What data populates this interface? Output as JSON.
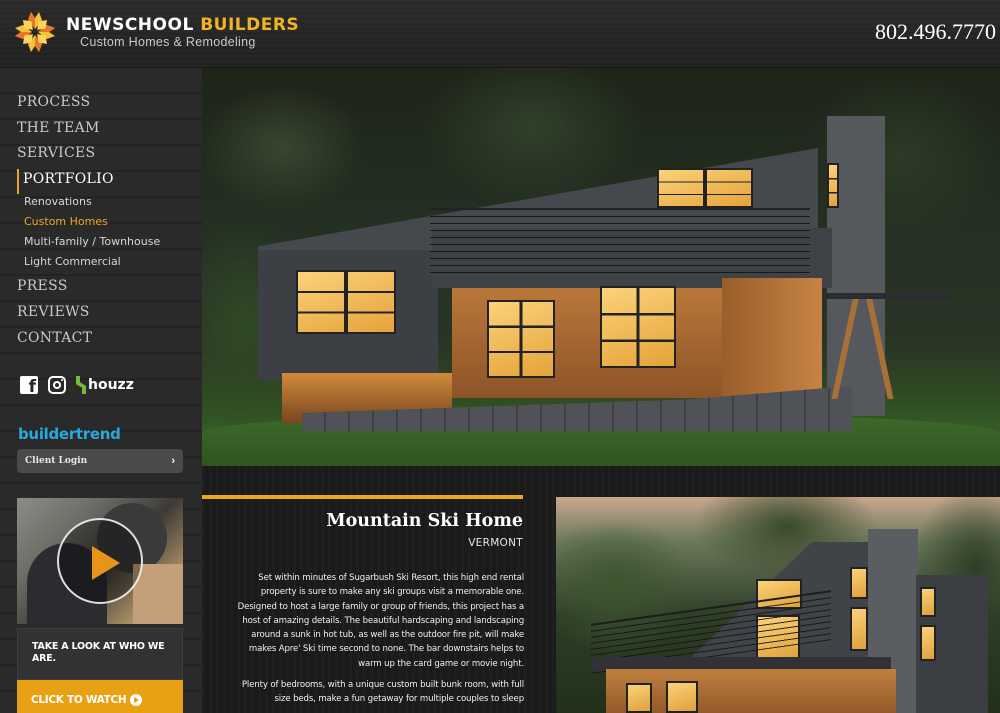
{
  "header": {
    "brand_primary": "NEWSCHOOL",
    "brand_secondary": "BUILDERS",
    "tagline": "Custom Homes & Remodeling",
    "phone": "802.496.7770",
    "colors": {
      "accent": "#f2b324",
      "background": "#262626"
    }
  },
  "nav": {
    "items": [
      {
        "label": "PROCESS"
      },
      {
        "label": "THE TEAM"
      },
      {
        "label": "SERVICES"
      },
      {
        "label": "PORTFOLIO",
        "active": true
      },
      {
        "label": "PRESS"
      },
      {
        "label": "REVIEWS"
      },
      {
        "label": "CONTACT"
      }
    ],
    "portfolio_sub": [
      {
        "label": "Renovations"
      },
      {
        "label": "Custom Homes",
        "current": true
      },
      {
        "label": "Multi-family / Townhouse"
      },
      {
        "label": "Light Commercial"
      }
    ]
  },
  "social": {
    "facebook_icon": "f",
    "instagram": "instagram-icon",
    "houzz_label": "houzz"
  },
  "buildertrend": {
    "logo": "buildertrend",
    "client_login_label": "Client Login",
    "chevron": "›"
  },
  "video_promo": {
    "caption": "TAKE A LOOK AT WHO WE ARE.",
    "button_label": "CLICK TO WATCH"
  },
  "project": {
    "title": "Mountain Ski Home",
    "location": "VERMONT",
    "paragraphs": [
      "Set within minutes of Sugarbush Ski Resort, this high end rental property is sure to make any ski groups visit a memorable one. Designed to host a large family or group of friends, this project has a host of amazing details. The beautiful hardscaping and landscaping around a sunk in hot tub, as well as the outdoor fire pit, will make makes Apre' Ski time second to none. The bar downstairs helps to warm up the card game or movie night.",
      "Plenty of bedrooms, with a unique custom built bunk room, with full size beds, make a fun getaway for multiple couples to sleep"
    ]
  }
}
